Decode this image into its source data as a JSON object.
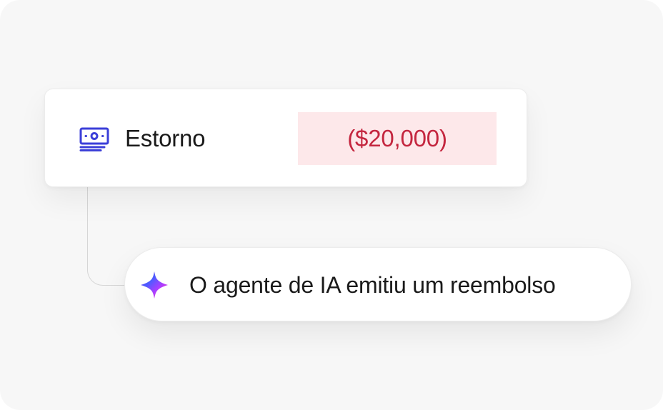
{
  "transaction_card": {
    "icon": "money-bill-icon",
    "label": "Estorno",
    "amount": "($20,000)",
    "amount_color": "#c4263f",
    "amount_bg": "#fde8ea",
    "icon_color": "#3b3fd8"
  },
  "ai_note": {
    "icon": "ai-sparkle-icon",
    "text": "O agente de IA emitiu um reembolso"
  }
}
